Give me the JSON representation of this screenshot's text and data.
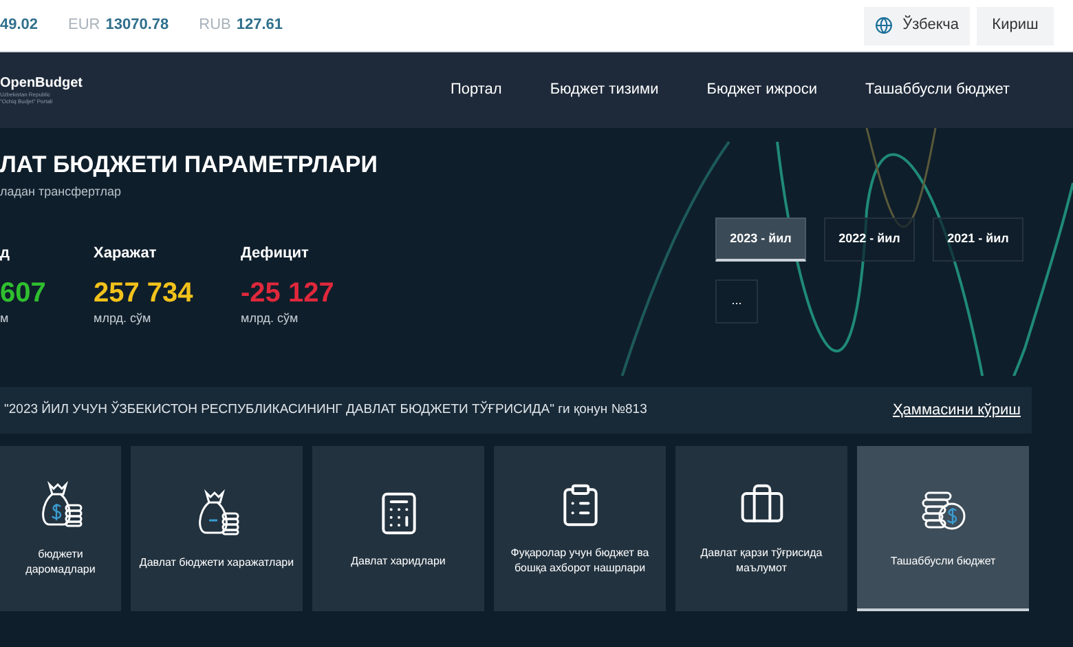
{
  "currencies": [
    {
      "value": "49.02"
    },
    {
      "code": "EUR",
      "value": "13070.78"
    },
    {
      "code": "RUB",
      "value": "127.61"
    }
  ],
  "language": {
    "label": "Ўзбекча"
  },
  "login": {
    "label": "Кириш"
  },
  "logo": {
    "name": "OpenBudget",
    "tagline": "Uzbekistan Republic\n\"Ochiq Budjet\" Portali"
  },
  "nav": [
    {
      "label": "Портал"
    },
    {
      "label": "Бюджет тизими"
    },
    {
      "label": "Бюджет ижроси"
    },
    {
      "label": "Ташаббусли бюджет"
    }
  ],
  "hero": {
    "title": "ЛАТ БЮДЖЕТИ ПАРАМЕТРЛАРИ",
    "subtitle": "ладан трансфертлар"
  },
  "stats": [
    {
      "label": "д",
      "value": "607",
      "unit": "м",
      "color": "#2fbf2f"
    },
    {
      "label": "Харажат",
      "value": "257 734",
      "unit": "млрд. сўм",
      "color": "#f2c21b"
    },
    {
      "label": "Дефицит",
      "value": "-25 127",
      "unit": "млрд. сўм",
      "color": "#e0283c"
    }
  ],
  "years": [
    {
      "label": "2023 - йил",
      "selected": true
    },
    {
      "label": "2022 - йил",
      "selected": false
    },
    {
      "label": "2021 - йил",
      "selected": false
    }
  ],
  "more_years": {
    "label": "..."
  },
  "law": {
    "text": "\"2023 ЙИЛ УЧУН ЎЗБЕКИСТОН РЕСПУБЛИКАСИНИНГ ДАВЛАТ БЮДЖЕТИ ТЎҒРИСИДА\" ги қонун №813",
    "link": "Ҳаммасини кўриш"
  },
  "cards": [
    {
      "kind": "bag-dollar",
      "label": "бюджети даромадлари",
      "selected": false
    },
    {
      "kind": "bag-minus",
      "label": "Давлат бюджети харажатлари",
      "selected": false
    },
    {
      "kind": "calculator",
      "label": "Давлат харидлари",
      "selected": false
    },
    {
      "kind": "clipboard",
      "label": "Фуқаролар учун бюджет ва бошқа ахборот нашрлари",
      "selected": false
    },
    {
      "kind": "briefcase",
      "label": "Давлат қарзи тўғрисида маълумот",
      "selected": false
    },
    {
      "kind": "coins",
      "label": "Ташаббусли бюджет",
      "selected": true
    }
  ]
}
